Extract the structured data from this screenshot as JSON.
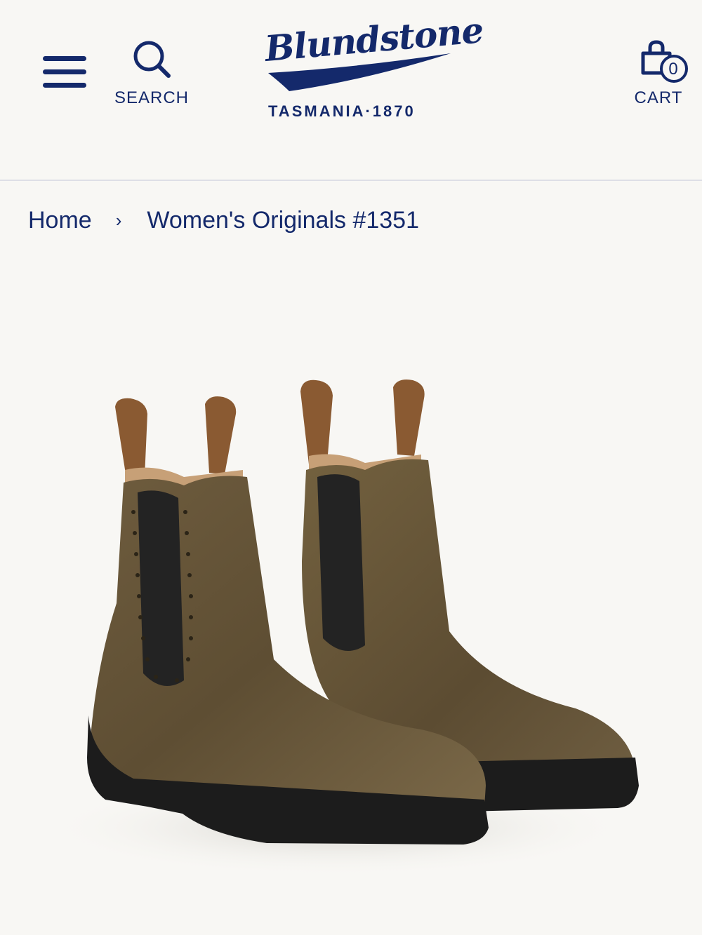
{
  "header": {
    "menu_icon": "hamburger-menu-icon",
    "search": {
      "label": "SEARCH",
      "icon": "search-icon"
    },
    "logo": {
      "wordmark": "Blundstone",
      "registered": "®",
      "tagline": "TASMANIA·1870"
    },
    "cart": {
      "label": "CART",
      "count": "0",
      "icon": "shopping-bag-icon"
    }
  },
  "breadcrumb": {
    "home": "Home",
    "separator": "›",
    "current": "Women's Originals #1351"
  },
  "product": {
    "image_alt": "Blundstone Women's Originals #1351 boots, pair",
    "colors": {
      "leather": "#6b5a3c",
      "elastic": "#222222",
      "sole": "#1c1c1c",
      "brand": "#14296b"
    }
  }
}
